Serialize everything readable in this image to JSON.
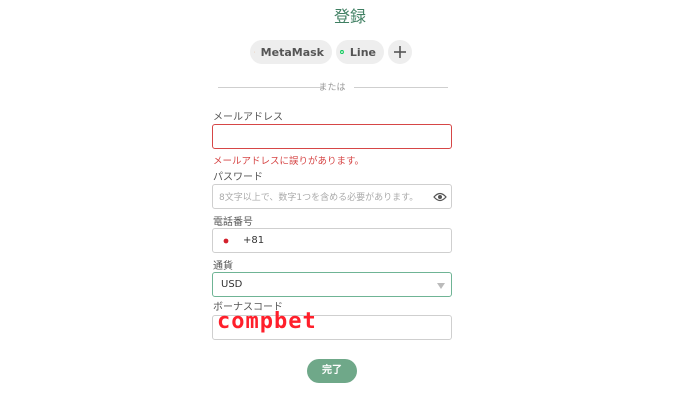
{
  "title": "登録",
  "social": {
    "metamask_label": "MetaMask",
    "line_label": "Line",
    "more_icon": "plus-icon"
  },
  "divider_text": "または",
  "email": {
    "label": "メールアドレス",
    "value": "",
    "placeholder": "",
    "error": "メールアドレスに誤りがあります。"
  },
  "password": {
    "label": "パスワード",
    "value": "",
    "placeholder": "8文字以上で、数字1つを含める必要があります。"
  },
  "phone": {
    "label": "電話番号",
    "country_code": "+81",
    "flag": "japan-flag-icon"
  },
  "currency": {
    "label": "通貨",
    "selected": "USD"
  },
  "bonus": {
    "label": "ボーナスコード",
    "value": ""
  },
  "watermark": "compbet",
  "submit_label": "完了",
  "colors": {
    "accent": "#3f7f62",
    "button": "#6fa889",
    "error": "#d64646",
    "watermark": "#ff1f2b"
  }
}
